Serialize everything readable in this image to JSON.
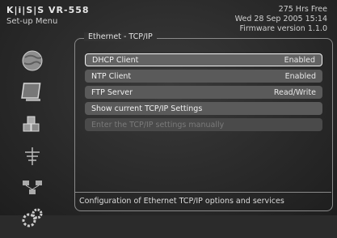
{
  "header": {
    "logo": "K|i|S|S VR-558",
    "subtitle": "Set-up Menu",
    "status": {
      "free": "275 Hrs Free",
      "datetime": "Wed 28 Sep 2005 15:14",
      "firmware": "Firmware version 1.1.0"
    }
  },
  "panel": {
    "title": "Ethernet - TCP/IP"
  },
  "menu": {
    "items": [
      {
        "label": "DHCP Client",
        "value": "Enabled"
      },
      {
        "label": "NTP Client",
        "value": "Enabled"
      },
      {
        "label": "FTP Server",
        "value": "Read/Write"
      },
      {
        "label": "Show current TCP/IP Settings",
        "value": ""
      },
      {
        "label": "Enter the TCP/IP settings manually",
        "value": ""
      }
    ]
  },
  "footer": {
    "help": "Configuration of Ethernet TCP/IP options and services"
  },
  "icons": [
    "globe-icon",
    "monitor-icon",
    "blocks-icon",
    "antenna-icon",
    "network-icon",
    "gears-icon"
  ]
}
